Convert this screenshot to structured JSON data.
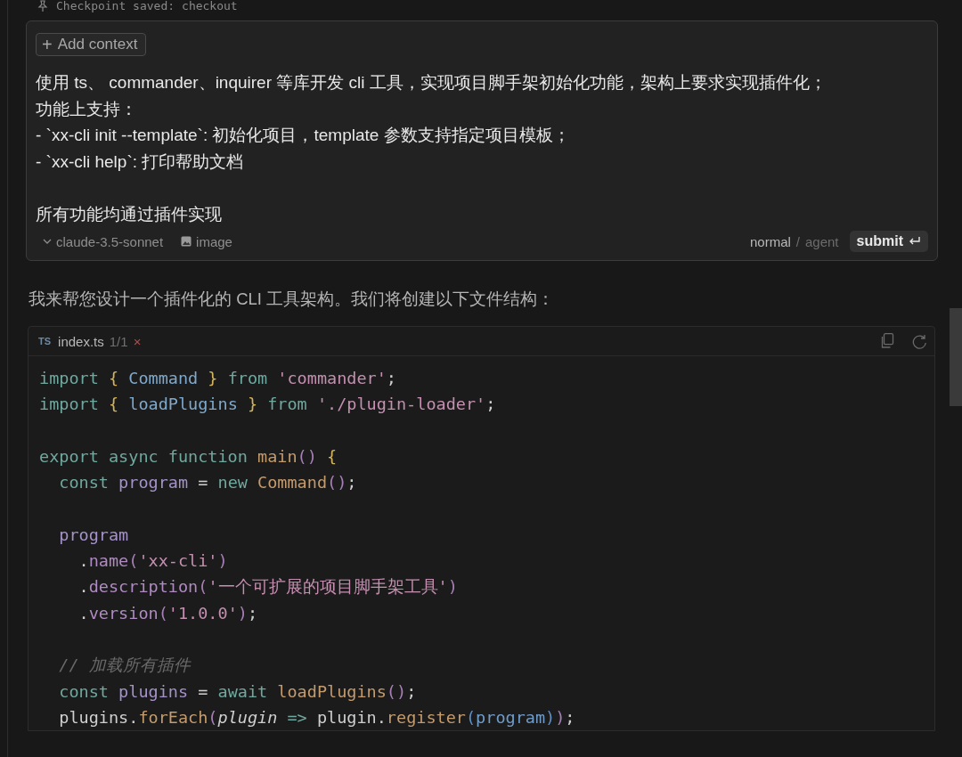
{
  "checkpoint": {
    "label": "Checkpoint saved:",
    "name": "checkout"
  },
  "prompt": {
    "add_context": {
      "icon": "+",
      "label": "Add context"
    },
    "paragraphs": [
      [
        "使用 ts、 commander、inquirer 等库开发 cli 工具，实现项目脚手架初始化功能，架构上要求实现插件化；",
        "功能上支持：",
        "- `xx-cli init --template`: 初始化项目，template 参数支持指定项目模板；",
        "- `xx-cli help`: 打印帮助文档"
      ],
      [
        "所有功能均通过插件实现"
      ]
    ],
    "model": "claude-3.5-sonnet",
    "image_label": "image",
    "modes": [
      {
        "label": "normal",
        "selected": true
      },
      {
        "label": "agent",
        "selected": false
      }
    ],
    "mode_separator": "/",
    "submit": "submit"
  },
  "response": "我来帮您设计一个插件化的 CLI 工具架构。我们将创建以下文件结构：",
  "code_block": {
    "lang": "TS",
    "filename": "index.ts",
    "count": "1/1",
    "close": "×",
    "lines": [
      {
        "kind": "code",
        "tokens": [
          {
            "text": "import",
            "kind": "keyword"
          },
          {
            "text": " {",
            "kind": "brace"
          },
          {
            "text": " Command ",
            "kind": "class"
          },
          {
            "text": "}",
            "kind": "brace"
          },
          {
            "text": " from ",
            "kind": "keyword"
          },
          {
            "text": "'commander'",
            "kind": "string"
          },
          {
            "text": ";",
            "kind": "plain"
          }
        ]
      },
      {
        "kind": "code",
        "tokens": [
          {
            "text": "import",
            "kind": "keyword"
          },
          {
            "text": " {",
            "kind": "brace"
          },
          {
            "text": " loadPlugins ",
            "kind": "class"
          },
          {
            "text": "}",
            "kind": "brace"
          },
          {
            "text": " from ",
            "kind": "keyword"
          },
          {
            "text": "'./plugin-loader'",
            "kind": "string"
          },
          {
            "text": ";",
            "kind": "plain"
          }
        ]
      },
      {
        "kind": "blank"
      },
      {
        "kind": "code",
        "tokens": [
          {
            "text": "export async function ",
            "kind": "keyword"
          },
          {
            "text": "main",
            "kind": "function"
          },
          {
            "text": "() ",
            "kind": "paren"
          },
          {
            "text": "{",
            "kind": "brace"
          }
        ]
      },
      {
        "kind": "code",
        "tokens": [
          {
            "text": "  const ",
            "kind": "keyword"
          },
          {
            "text": "program",
            "kind": "variable"
          },
          {
            "text": " = ",
            "kind": "plain"
          },
          {
            "text": "new ",
            "kind": "keyword"
          },
          {
            "text": "Command",
            "kind": "function"
          },
          {
            "text": "()",
            "kind": "paren"
          },
          {
            "text": ";",
            "kind": "plain"
          }
        ]
      },
      {
        "kind": "blank"
      },
      {
        "kind": "code",
        "tokens": [
          {
            "text": "  program",
            "kind": "variable"
          }
        ]
      },
      {
        "kind": "code",
        "tokens": [
          {
            "text": "    .",
            "kind": "plain"
          },
          {
            "text": "name",
            "kind": "property"
          },
          {
            "text": "(",
            "kind": "paren"
          },
          {
            "text": "'xx-cli'",
            "kind": "string"
          },
          {
            "text": ")",
            "kind": "paren"
          }
        ]
      },
      {
        "kind": "code",
        "tokens": [
          {
            "text": "    .",
            "kind": "plain"
          },
          {
            "text": "description",
            "kind": "property"
          },
          {
            "text": "(",
            "kind": "paren"
          },
          {
            "text": "'一个可扩展的项目脚手架工具'",
            "kind": "string"
          },
          {
            "text": ")",
            "kind": "paren"
          }
        ]
      },
      {
        "kind": "code",
        "tokens": [
          {
            "text": "    .",
            "kind": "plain"
          },
          {
            "text": "version",
            "kind": "property"
          },
          {
            "text": "(",
            "kind": "paren"
          },
          {
            "text": "'1.0.0'",
            "kind": "string"
          },
          {
            "text": ")",
            "kind": "paren"
          },
          {
            "text": ";",
            "kind": "plain"
          }
        ]
      },
      {
        "kind": "blank"
      },
      {
        "kind": "code",
        "tokens": [
          {
            "text": "  // 加载所有插件",
            "kind": "comment"
          }
        ]
      },
      {
        "kind": "code",
        "tokens": [
          {
            "text": "  const ",
            "kind": "keyword"
          },
          {
            "text": "plugins",
            "kind": "variable"
          },
          {
            "text": " = ",
            "kind": "plain"
          },
          {
            "text": "await ",
            "kind": "keyword"
          },
          {
            "text": "loadPlugins",
            "kind": "function"
          },
          {
            "text": "()",
            "kind": "paren"
          },
          {
            "text": ";",
            "kind": "plain"
          }
        ]
      },
      {
        "kind": "code",
        "tokens": [
          {
            "text": "  plugins.",
            "kind": "plain"
          },
          {
            "text": "forEach",
            "kind": "function"
          },
          {
            "text": "(",
            "kind": "paren"
          },
          {
            "text": "plugin",
            "kind": "parameter"
          },
          {
            "text": " => ",
            "kind": "keyword"
          },
          {
            "text": "plugin.",
            "kind": "plain"
          },
          {
            "text": "register",
            "kind": "function"
          },
          {
            "text": "(",
            "kind": "innerparen"
          },
          {
            "text": "program",
            "kind": "argument"
          },
          {
            "text": ")",
            "kind": "innerparen"
          },
          {
            "text": ")",
            "kind": "paren"
          },
          {
            "text": ";",
            "kind": "plain"
          }
        ]
      }
    ]
  }
}
